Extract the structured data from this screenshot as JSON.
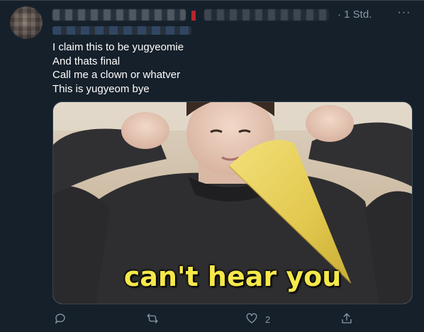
{
  "tweet": {
    "timestamp": "· 1 Std.",
    "more_label": "···",
    "text_lines": [
      "I claim this to be yugyeomie",
      "And thats final",
      "Call me a clown or whatver",
      "This is yugyeom bye"
    ],
    "media": {
      "caption": "can't hear you"
    },
    "actions": {
      "reply_icon": "reply-icon",
      "retweet_icon": "retweet-icon",
      "like_icon": "heart-icon",
      "like_count": "2",
      "share_icon": "share-icon"
    }
  },
  "colors": {
    "background": "#15202b",
    "text": "#ffffff",
    "secondary_text": "#8899a6",
    "caption": "#f5e84a"
  }
}
